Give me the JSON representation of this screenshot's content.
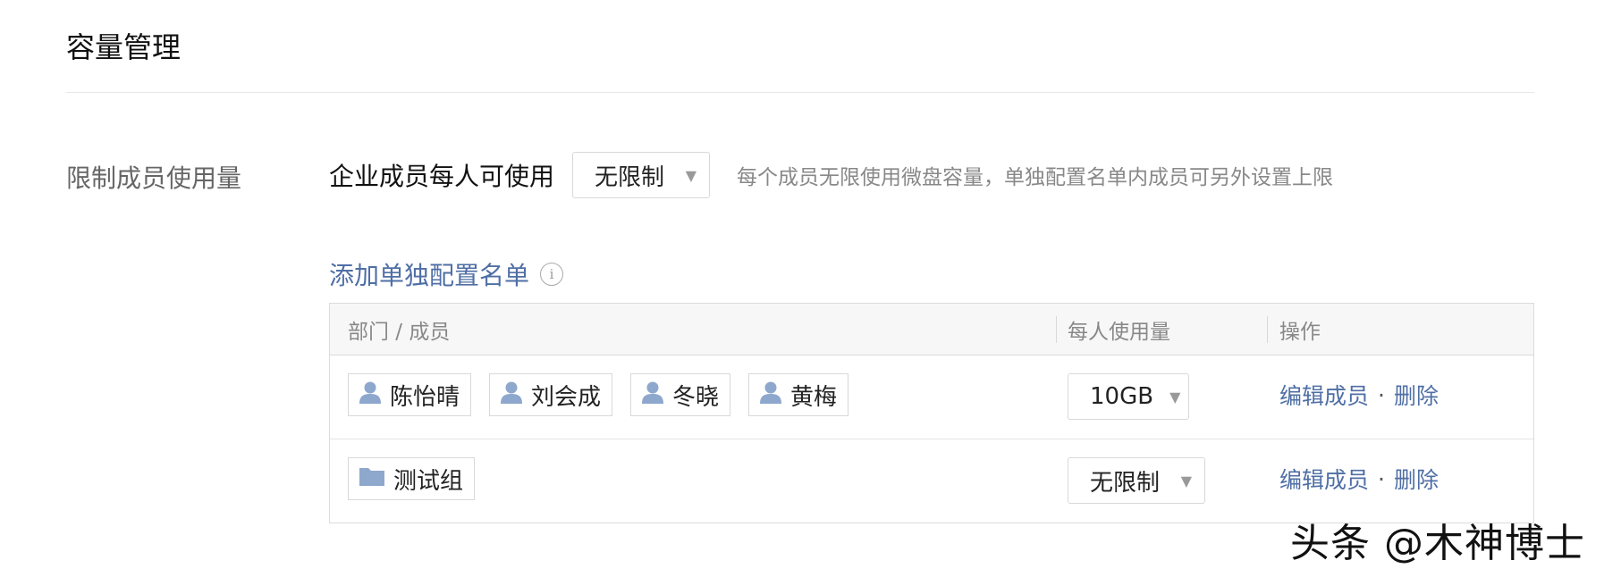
{
  "page": {
    "title": "容量管理"
  },
  "limit_section": {
    "label": "限制成员使用量",
    "per_member_text": "企业成员每人可使用",
    "per_member_select": "无限制",
    "hint": "每个成员无限使用微盘容量，单独配置名单内成员可另外设置上限"
  },
  "config_list": {
    "add_link": "添加单独配置名单",
    "info_icon": "i",
    "columns": [
      "部门 / 成员",
      "每人使用量",
      "操作"
    ],
    "rows": [
      {
        "members": [
          {
            "name": "陈怡晴",
            "icon": "user-icon"
          },
          {
            "name": "刘会成",
            "icon": "user-icon"
          },
          {
            "name": "冬晓",
            "icon": "user-icon"
          },
          {
            "name": "黄梅",
            "icon": "user-icon"
          }
        ],
        "usage": "10GB",
        "edit": "编辑成员",
        "sep": "·",
        "delete": "删除"
      },
      {
        "members": [
          {
            "name": "测试组",
            "icon": "folder-icon"
          }
        ],
        "usage": "无限制",
        "edit": "编辑成员",
        "sep": "·",
        "delete": "删除"
      }
    ]
  },
  "watermark": "头条 @木神博士",
  "colors": {
    "link": "#4f6fa5",
    "icon": "#8ea7cc"
  }
}
